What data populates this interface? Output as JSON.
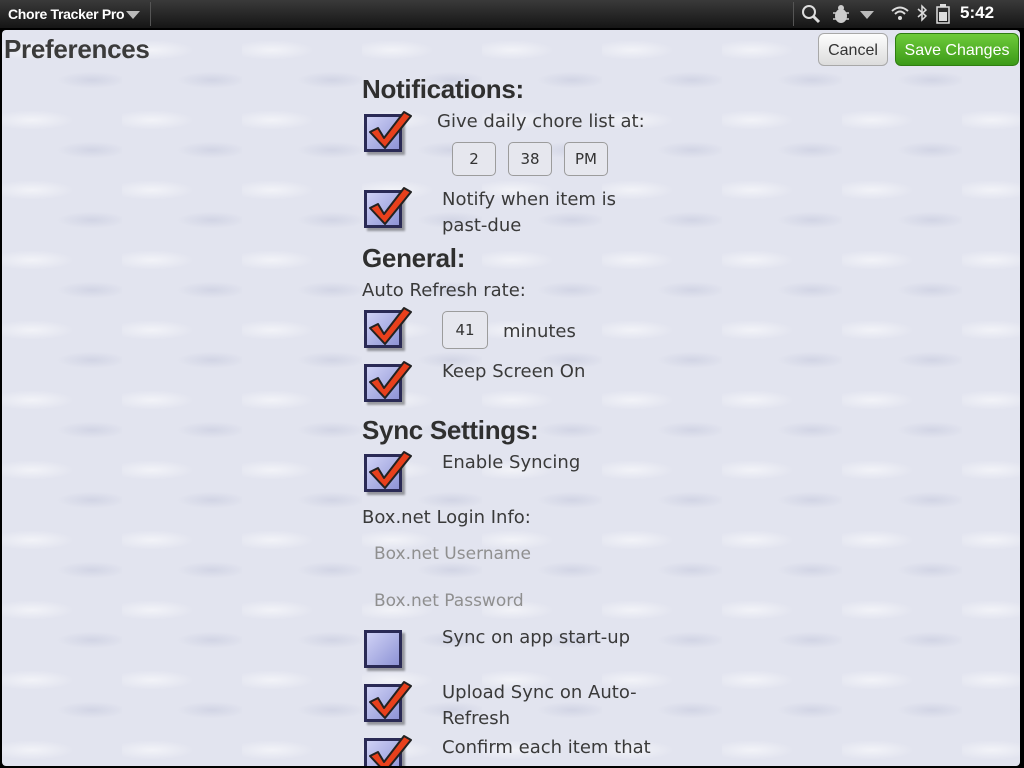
{
  "statusbar": {
    "app_title": "Chore Tracker Pro",
    "time": "5:42",
    "icons": [
      "search-icon",
      "bug-icon",
      "menu-down-icon",
      "wifi-icon",
      "bluetooth-icon",
      "battery-icon"
    ]
  },
  "header": {
    "title": "Preferences",
    "cancel_label": "Cancel",
    "save_label": "Save Changes"
  },
  "notifications": {
    "heading": "Notifications:",
    "daily_label": "Give daily chore list at:",
    "daily_checked": true,
    "hour": "2",
    "minute": "38",
    "ampm": "PM",
    "pastdue_line1": "Notify when item is",
    "pastdue_line2": "past-due",
    "pastdue_checked": true
  },
  "general": {
    "heading": "General:",
    "refresh_label": "Auto Refresh rate:",
    "refresh_checked": true,
    "refresh_value": "41",
    "refresh_unit": "minutes",
    "screen_label": "Keep Screen On",
    "screen_checked": true
  },
  "sync": {
    "heading": "Sync Settings:",
    "enable_label": "Enable Syncing",
    "enable_checked": true,
    "login_label": "Box.net Login Info:",
    "username_placeholder": "Box.net Username",
    "password_placeholder": "Box.net Password",
    "startup_label": "Sync on app start-up",
    "startup_checked": false,
    "upload_line1": "Upload Sync on Auto-",
    "upload_line2": "Refresh",
    "upload_checked": true,
    "confirm_line1": "Confirm each item that",
    "confirm_checked": true
  }
}
